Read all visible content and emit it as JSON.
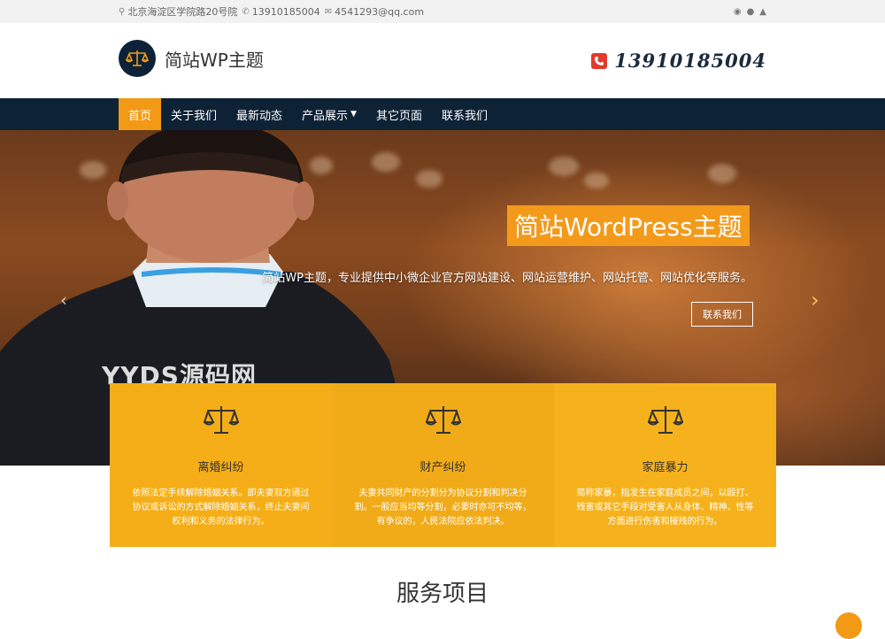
{
  "topbar": {
    "address": "北京海淀区学院路20号院",
    "phone": "13910185004",
    "email": "4541293@qq.com",
    "social_icons": [
      "weibo-icon",
      "wechat-icon",
      "qq-icon"
    ]
  },
  "header": {
    "site_name": "简站WP主题",
    "hotline": "13910185004"
  },
  "nav": {
    "items": [
      {
        "label": "首页",
        "active": true
      },
      {
        "label": "关于我们"
      },
      {
        "label": "最新动态"
      },
      {
        "label": "产品展示",
        "dropdown": true
      },
      {
        "label": "其它页面"
      },
      {
        "label": "联系我们"
      }
    ]
  },
  "hero": {
    "title": "简站WordPress主题",
    "subtitle": "简站WP主题，专业提供中小微企业官方网站建设、网站运营维护、网站托管、网站优化等服务。",
    "button": "联系我们",
    "watermark": "YYDS源码网"
  },
  "cards": [
    {
      "title": "离婚纠纷",
      "desc": "依照法定手续解除婚姻关系。即夫妻双方通过协议或诉讼的方式解除婚姻关系，终止夫妻间权利和义务的法律行为。"
    },
    {
      "title": "财产纠纷",
      "desc": "夫妻共同财产的分割分为协议分割和判决分割。一般应当均等分割，必要时亦可不均等，有争议的，人民法院应依法判决。"
    },
    {
      "title": "家庭暴力",
      "desc": "简称家暴，指发生在家庭成员之间，以殴打、残害或其它手段对受害人从身体、精神、性等方面进行伤害和摧残的行为。"
    }
  ],
  "section": {
    "title": "服务项目"
  },
  "colors": {
    "accent": "#f29a15",
    "nav_bg": "#0e2235",
    "card_bg": "#f5ae17"
  }
}
